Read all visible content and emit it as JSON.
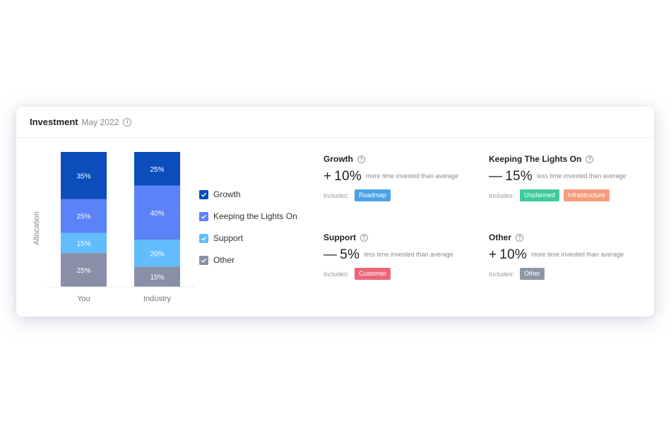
{
  "card": {
    "title": "Investment",
    "date": "May 2022",
    "info_icon": "info-icon"
  },
  "chart_data": {
    "type": "bar",
    "stacked": true,
    "title": "",
    "xlabel": "",
    "ylabel": "Allocation",
    "ylim": [
      0,
      100
    ],
    "grid": false,
    "legend_placement": "right",
    "categories": [
      "You",
      "Industry"
    ],
    "series": [
      {
        "name": "Other",
        "color": "#8a8fa8",
        "values": [
          25,
          15
        ]
      },
      {
        "name": "Support",
        "color": "#62bdfd",
        "values": [
          15,
          20
        ]
      },
      {
        "name": "Keeping the Lights On",
        "color": "#5b82f7",
        "values": [
          25,
          40
        ]
      },
      {
        "name": "Growth",
        "color": "#0a4dbb",
        "values": [
          35,
          25
        ]
      }
    ],
    "value_labels": true,
    "value_label_suffix": "%"
  },
  "legend": {
    "items": [
      {
        "label": "Growth",
        "color": "#0a4dbb",
        "checked": true
      },
      {
        "label": "Keeping the Lights On",
        "color": "#5b82f7",
        "checked": true
      },
      {
        "label": "Support",
        "color": "#62bdfd",
        "checked": true
      },
      {
        "label": "Other",
        "color": "#8a8fa8",
        "checked": true
      }
    ]
  },
  "metrics": [
    {
      "title": "Growth",
      "sign": "+",
      "value": "10%",
      "description": "more time invested than average",
      "includes_label": "Includes:",
      "tags": [
        {
          "label": "Roadmap",
          "color": "#4aa3e6"
        }
      ]
    },
    {
      "title": "Keeping The Lights On",
      "sign": "—",
      "value": "15%",
      "description": "less time invested than average",
      "includes_label": "Includes:",
      "tags": [
        {
          "label": "Unplanned",
          "color": "#3ecb9a"
        },
        {
          "label": "Infrastructure",
          "color": "#f79c7c"
        }
      ]
    },
    {
      "title": "Support",
      "sign": "—",
      "value": "5%",
      "description": "less time invested than average",
      "includes_label": "Includes:",
      "tags": [
        {
          "label": "Customer",
          "color": "#ec6679"
        }
      ]
    },
    {
      "title": "Other",
      "sign": "+",
      "value": "10%",
      "description": "more time invested than average",
      "includes_label": "Includes:",
      "tags": [
        {
          "label": "Other",
          "color": "#8b98a4"
        }
      ]
    }
  ]
}
